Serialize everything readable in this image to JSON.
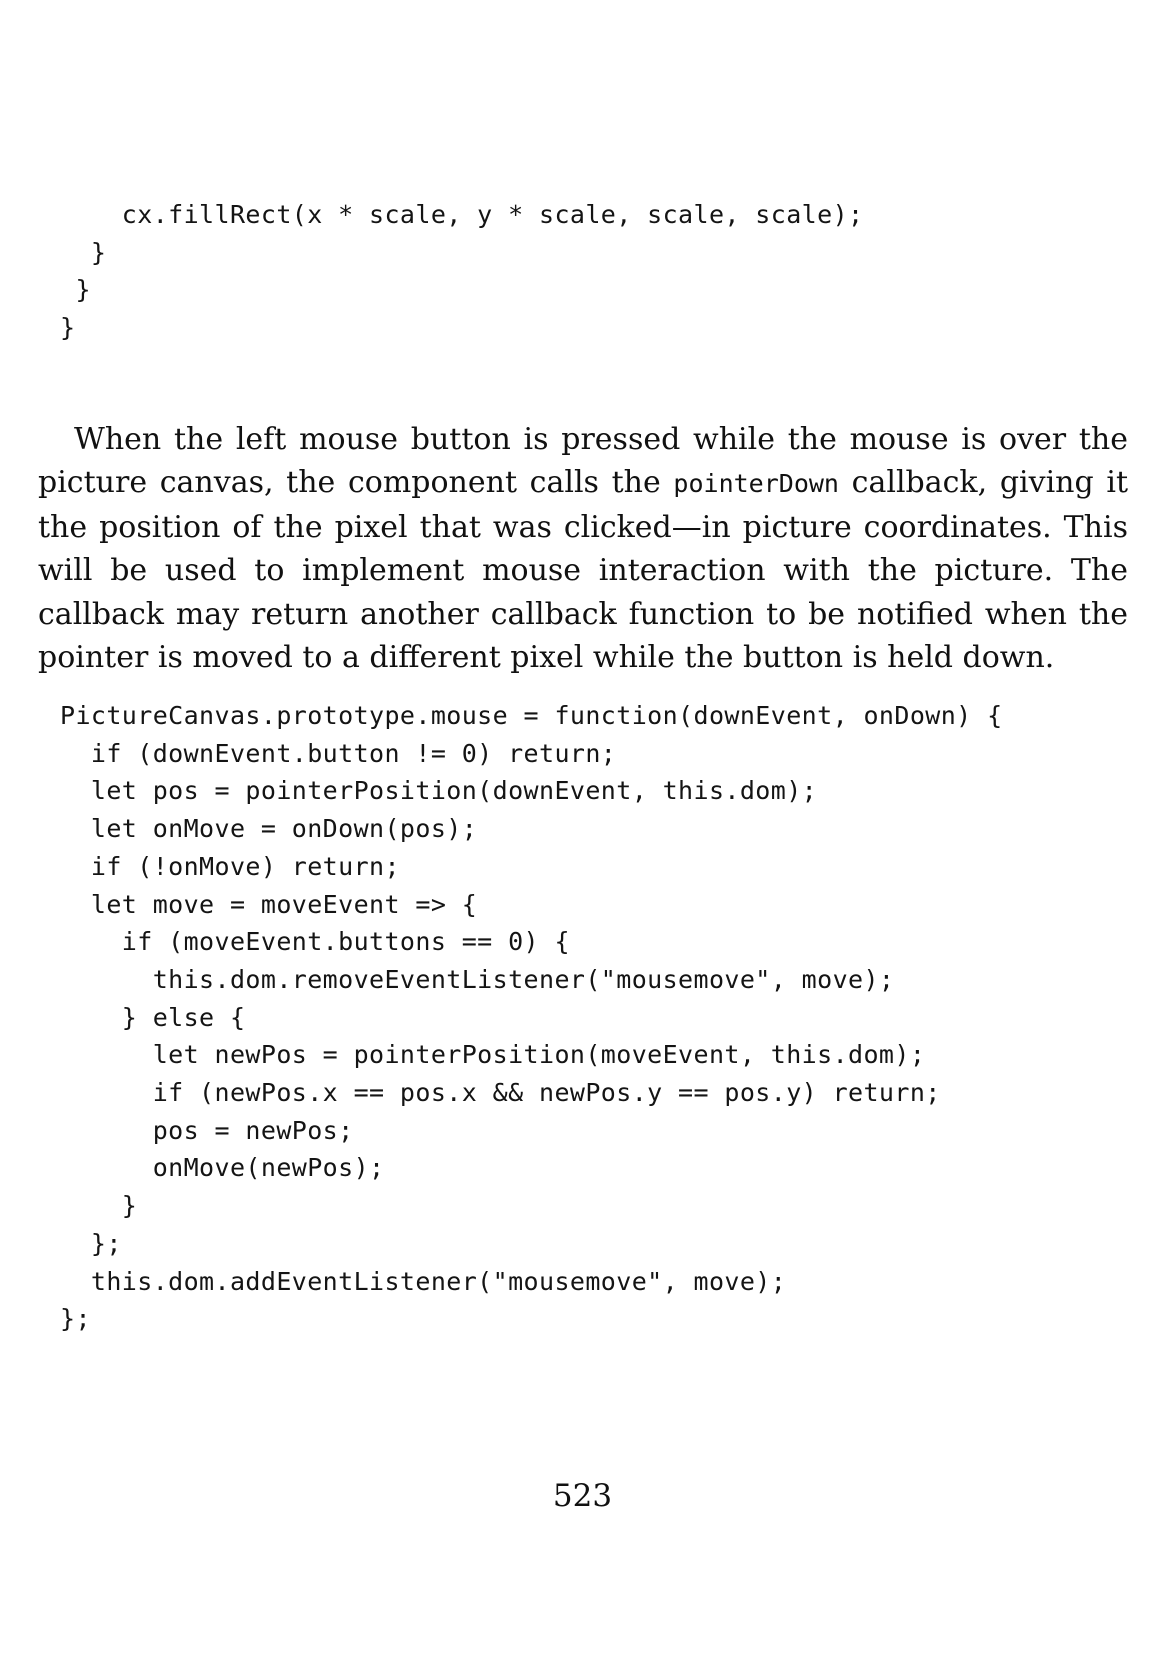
{
  "code_top": {
    "lines": [
      "    cx.fillRect(x * scale, y * scale, scale, scale);",
      "  }",
      " }",
      "}"
    ]
  },
  "paragraph": {
    "text_before": "When the left mouse button is pressed while the mouse is over the picture canvas, the component calls the ",
    "inline_code": "pointerDown",
    "text_after": " callback, giving it the position of the pixel that was clicked—in picture coordinates. This will be used to implement mouse interaction with the picture. The callback may return another callback function to be notified when the pointer is moved to a different pixel while the button is held down."
  },
  "code_main": {
    "lines": [
      "PictureCanvas.prototype.mouse = function(downEvent, onDown) {",
      "  if (downEvent.button != 0) return;",
      "  let pos = pointerPosition(downEvent, this.dom);",
      "  let onMove = onDown(pos);",
      "  if (!onMove) return;",
      "  let move = moveEvent => {",
      "    if (moveEvent.buttons == 0) {",
      "      this.dom.removeEventListener(\"mousemove\", move);",
      "    } else {",
      "      let newPos = pointerPosition(moveEvent, this.dom);",
      "      if (newPos.x == pos.x && newPos.y == pos.y) return;",
      "      pos = newPos;",
      "      onMove(newPos);",
      "    }",
      "  };",
      "  this.dom.addEventListener(\"mousemove\", move);",
      "};"
    ]
  },
  "page_number": "523"
}
